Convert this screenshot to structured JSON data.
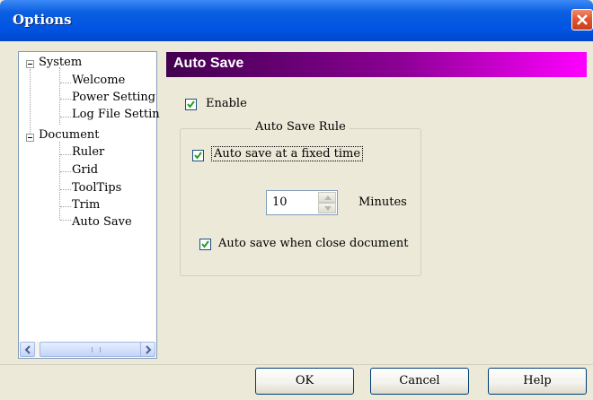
{
  "window": {
    "title": "Options"
  },
  "tree": {
    "items": [
      {
        "label": "System",
        "level": 0,
        "expanded": true
      },
      {
        "label": "Welcome",
        "level": 1
      },
      {
        "label": "Power Setting",
        "level": 1
      },
      {
        "label": "Log File Settin",
        "level": 1
      },
      {
        "label": "Document",
        "level": 0,
        "expanded": true
      },
      {
        "label": "Ruler",
        "level": 1
      },
      {
        "label": "Grid",
        "level": 1
      },
      {
        "label": "ToolTips",
        "level": 1
      },
      {
        "label": "Trim",
        "level": 1
      },
      {
        "label": "Auto Save",
        "level": 1,
        "selected": true
      }
    ]
  },
  "panel": {
    "header": "Auto Save",
    "enable": {
      "label": "Enable",
      "checked": true
    },
    "group_title": "Auto Save Rule",
    "fixed_time": {
      "label": "Auto save at a fixed time",
      "checked": true
    },
    "minutes": {
      "value": "10",
      "unit": "Minutes"
    },
    "on_close": {
      "label": "Auto save when close document",
      "checked": true
    }
  },
  "buttons": {
    "ok": "OK",
    "cancel": "Cancel",
    "help": "Help"
  },
  "colors": {
    "header_gradient_start": "#42004f",
    "header_gradient_end": "#ff00ff",
    "titlebar": "#0054e3",
    "close_button": "#e0532a"
  }
}
